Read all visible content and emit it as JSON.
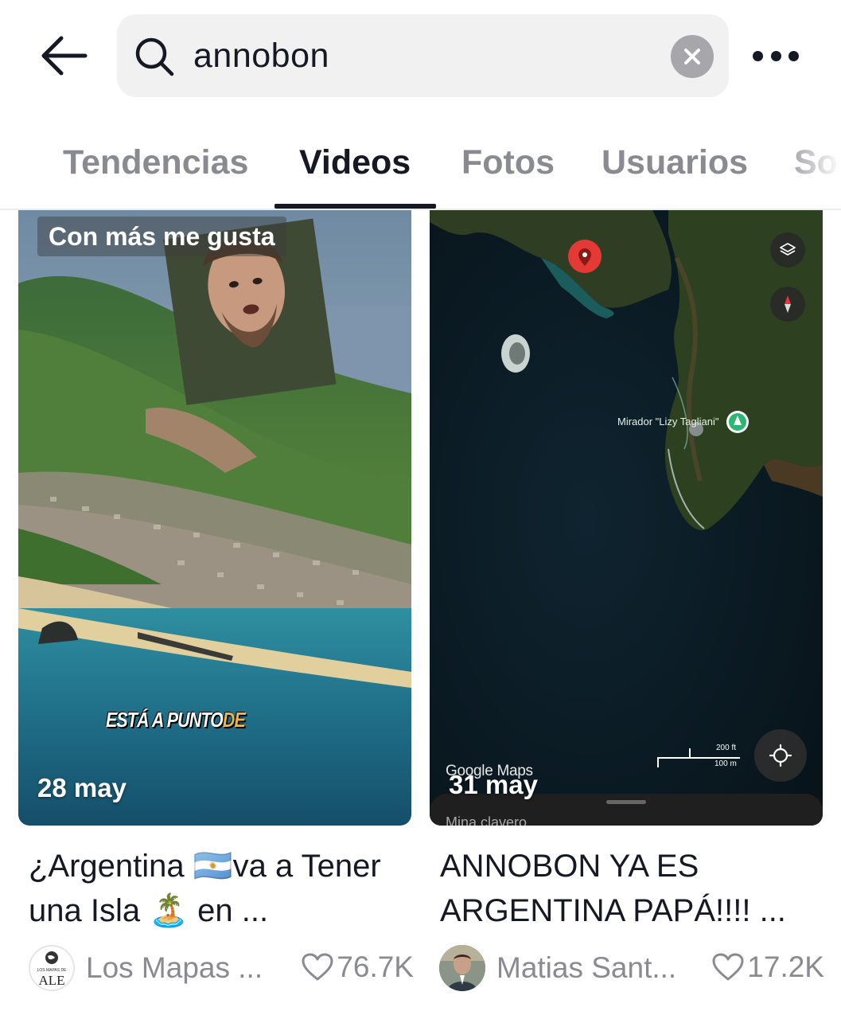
{
  "header": {
    "back_icon": "arrow-left-icon",
    "search_icon": "magnifier-icon",
    "search_value": "annobon",
    "clear_icon": "x-circle-icon",
    "more_icon": "ellipsis-icon"
  },
  "tabs": [
    {
      "label": "Tendencias",
      "active": false
    },
    {
      "label": "Videos",
      "active": true
    },
    {
      "label": "Fotos",
      "active": false
    },
    {
      "label": "Usuarios",
      "active": false
    },
    {
      "label": "So",
      "active": false
    }
  ],
  "results": [
    {
      "badge": "Con más me gusta",
      "overlay_text": "ESTÁ A PUNTO",
      "overlay_highlight": "DE",
      "date": "28 may",
      "caption": "¿Argentina 🇦🇷va a Tener una Isla 🏝️ en ...",
      "author": "Los Mapas ...",
      "avatar_text_top": "LOS MAPAS DE",
      "avatar_text": "ALE",
      "likes": "76.7K"
    },
    {
      "map_label": "Mirador \"Lizy Tagliani\"",
      "scale_ft": "200 ft",
      "scale_m": "100 m",
      "watermark": "Google Maps",
      "sheet_text": "Mina clavero",
      "date": "31 may",
      "caption": "ANNOBON YA ES ARGENTINA PAPÁ!!!! ...",
      "author": "Matias Sant...",
      "likes": "17.2K"
    }
  ],
  "colors": {
    "text_primary": "#161823",
    "text_secondary": "#8a8b91",
    "search_bg": "#f1f1f2",
    "map_pin": "#e53935",
    "map_marker_green": "#2bb673",
    "overlay_highlight": "#e8b84a"
  }
}
